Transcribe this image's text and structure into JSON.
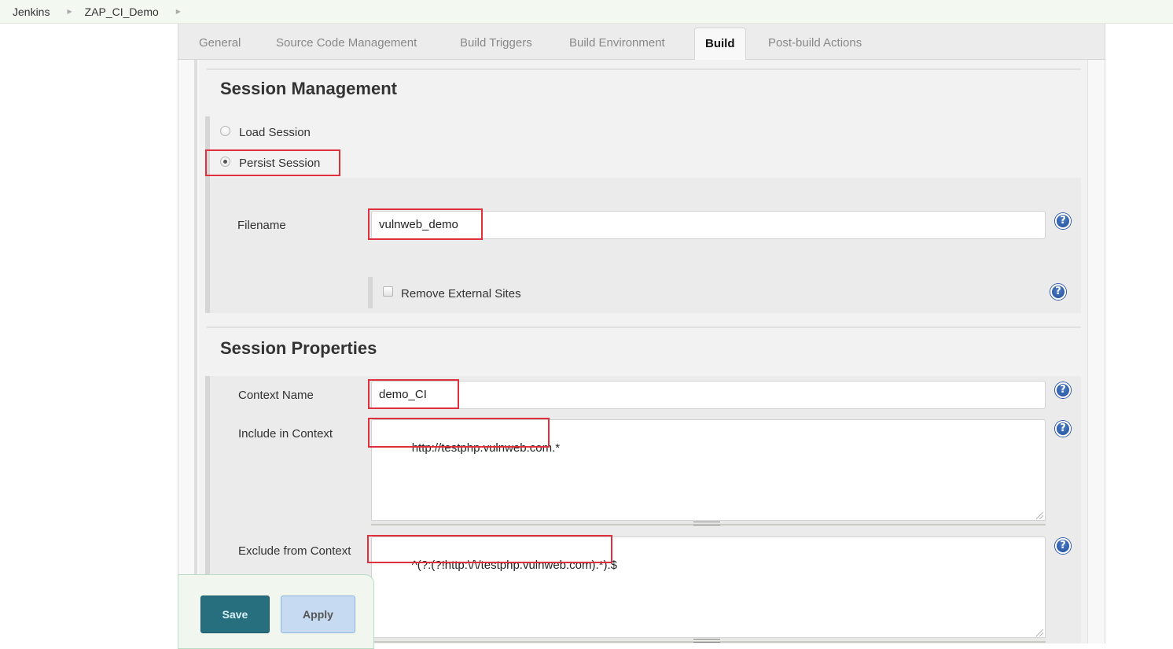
{
  "breadcrumb": {
    "items": [
      "Jenkins",
      "ZAP_CI_Demo"
    ],
    "separator_icon": "chevron-right-icon"
  },
  "tabs": [
    {
      "label": "General",
      "active": false
    },
    {
      "label": "Source Code Management",
      "active": false
    },
    {
      "label": "Build Triggers",
      "active": false
    },
    {
      "label": "Build Environment",
      "active": false
    },
    {
      "label": "Build",
      "active": true
    },
    {
      "label": "Post-build Actions",
      "active": false
    }
  ],
  "session_management": {
    "title": "Session Management",
    "options": [
      {
        "label": "Load Session",
        "selected": false
      },
      {
        "label": "Persist Session",
        "selected": true
      }
    ],
    "filename": {
      "label": "Filename",
      "value": "vulnweb_demo"
    },
    "remove_external_sites": {
      "label": "Remove External Sites",
      "checked": false
    }
  },
  "session_properties": {
    "title": "Session Properties",
    "context_name": {
      "label": "Context Name",
      "value": "demo_CI"
    },
    "include_in_context": {
      "label": "Include in Context",
      "value": "http://testphp.vulnweb.com.*"
    },
    "exclude_from_context": {
      "label": "Exclude from Context",
      "value": "^(?:(?!http:\\/\\/testphp.vulnweb.com).*).$"
    }
  },
  "help_icon_glyph": "?",
  "actions": {
    "save_label": "Save",
    "apply_label": "Apply"
  },
  "colors": {
    "highlight": "#e0303e",
    "save_button": "#276e7f",
    "apply_button": "#c6dbf1",
    "help_icon": "#2b5aa8"
  }
}
